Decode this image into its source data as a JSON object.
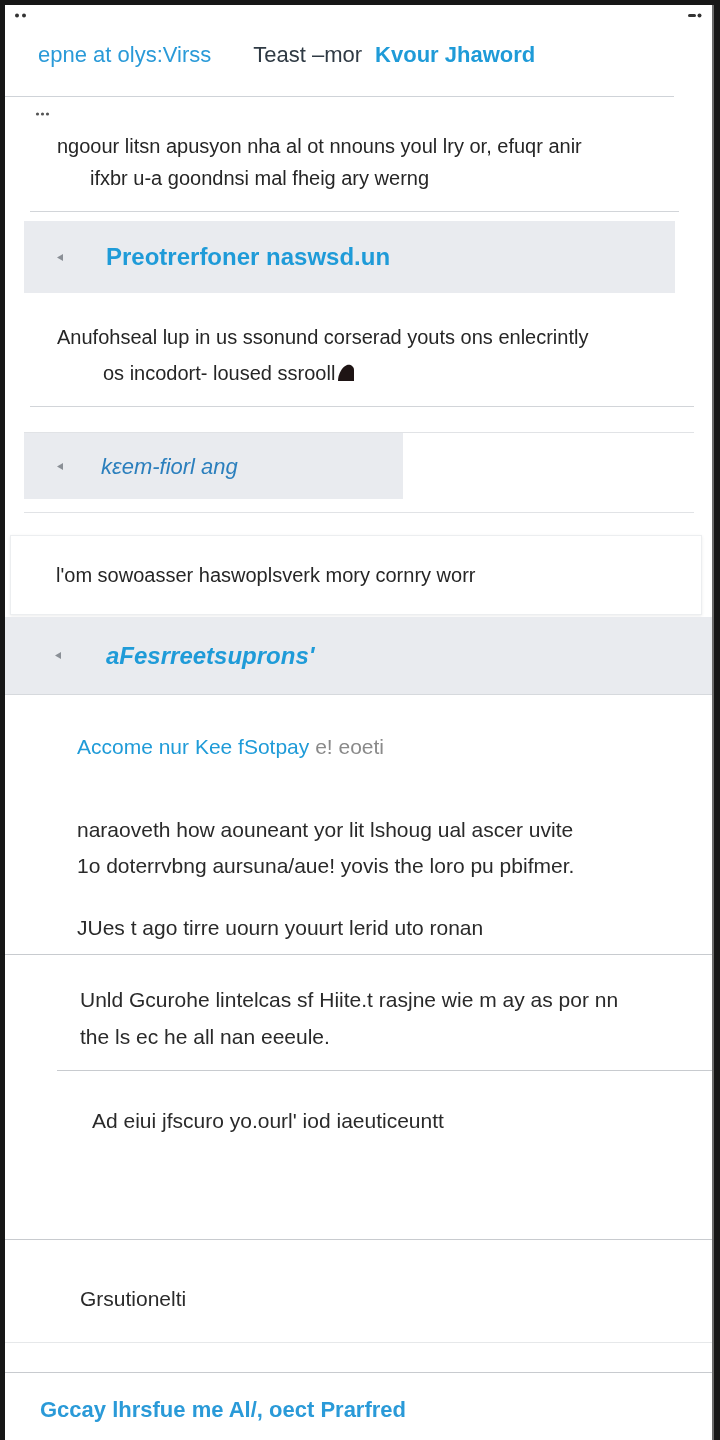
{
  "top_bar": {
    "items": [
      {
        "kind": "link",
        "text": "epne at olys:Virss"
      },
      {
        "kind": "plain",
        "text": "Teast –mor"
      },
      {
        "kind": "bold",
        "text": "Kvour Jhaword"
      }
    ]
  },
  "blocks": [
    {
      "kind": "paragraph",
      "more_icon": true,
      "lines": [
        "ngoour litsn apusyon nha al ot nnouns youl lry or, efuqr anir",
        "ifxbr u-a goondnsi mal fheig ary werng"
      ]
    },
    {
      "kind": "band",
      "title": "Preotrerfoner naswsd.un"
    },
    {
      "kind": "paragraph",
      "end_icon": true,
      "lines": [
        "Anufohseal lup in us ssonund corserad youts ons enlecrintly",
        "os incodort- loused ssrooll"
      ]
    },
    {
      "kind": "tab",
      "title": "kεem-fiorl ang"
    },
    {
      "kind": "card",
      "text": "l'om sowoasser haswoplsverk mory cornry worr"
    },
    {
      "kind": "band",
      "title": "aFesrreetsuprons'"
    }
  ],
  "section": {
    "lead": {
      "link": "Accome nur Kee fSotpay",
      "rest": "e! eoeti"
    },
    "groups": [
      {
        "paragraphs": [
          [
            "naraoveth how aounеant yor lit lshoug ual ascer uvite",
            "1o doterrvbng aursuna/aue! yovis the loro pu pbifmer."
          ],
          [
            "JUes t ago tirre uourn youurt lerid uto ronan"
          ]
        ]
      },
      {
        "paragraphs": [
          [
            "Unld Gcurohe lintelcas sf Hiite.t rasjne wie m ay as por nn",
            "the ls ec he all nan eeeule."
          ]
        ]
      },
      {
        "paragraphs": [
          [
            "Ad eiui jfscuro yo.ourl' iod iaeuticeuntt"
          ]
        ]
      },
      {
        "paragraphs": [
          [
            "Grsutionelti"
          ]
        ]
      }
    ]
  },
  "footer": {
    "text": "Gccay lhrsfue me Al/, oect Prarfred"
  }
}
